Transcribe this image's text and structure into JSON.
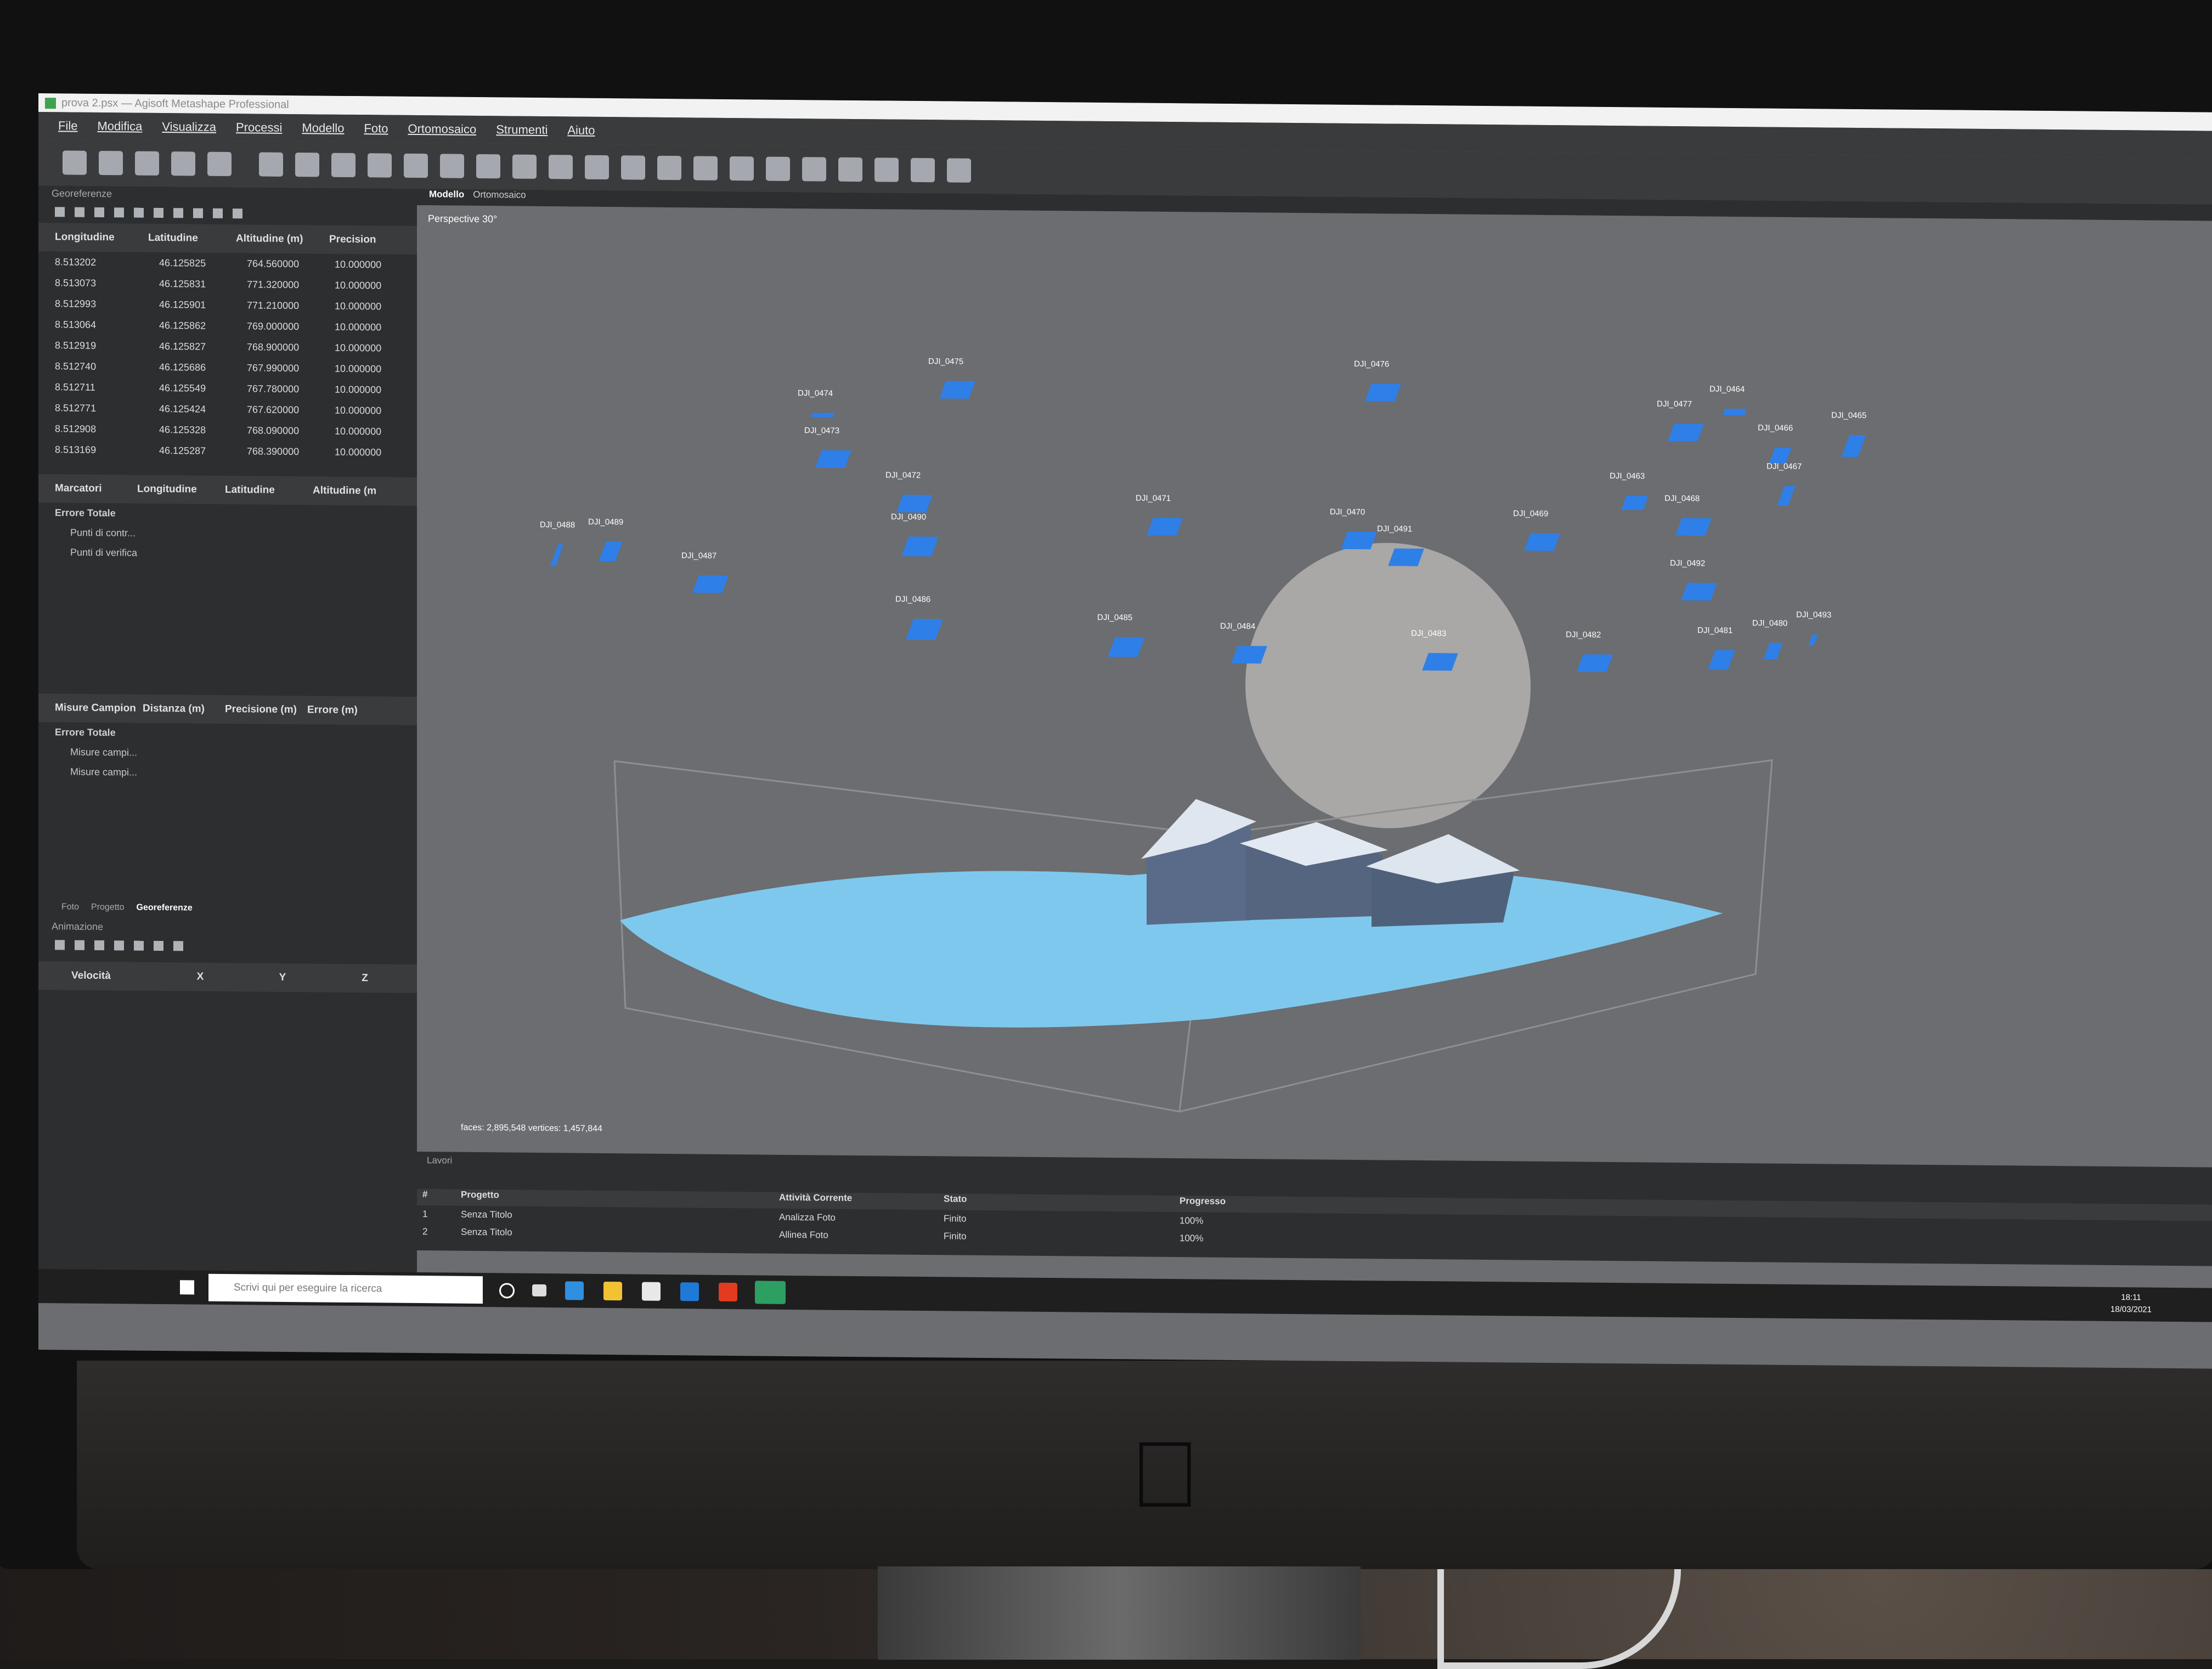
{
  "window": {
    "title": "prova 2.psx — Agisoft Metashape Professional"
  },
  "menu": [
    "File",
    "Modifica",
    "Visualizza",
    "Processi",
    "Modello",
    "Foto",
    "Ortomosaico",
    "Strumenti",
    "Aiuto"
  ],
  "georef": {
    "title": "Georeferenze",
    "columns": [
      "Longitudine",
      "Latitudine",
      "Altitudine (m)",
      "Precision"
    ],
    "rows": [
      [
        "8.513202",
        "46.125825",
        "764.560000",
        "10.000000"
      ],
      [
        "8.513073",
        "46.125831",
        "771.320000",
        "10.000000"
      ],
      [
        "8.512993",
        "46.125901",
        "771.210000",
        "10.000000"
      ],
      [
        "8.513064",
        "46.125862",
        "769.000000",
        "10.000000"
      ],
      [
        "8.512919",
        "46.125827",
        "768.900000",
        "10.000000"
      ],
      [
        "8.512740",
        "46.125686",
        "767.990000",
        "10.000000"
      ],
      [
        "8.512711",
        "46.125549",
        "767.780000",
        "10.000000"
      ],
      [
        "8.512771",
        "46.125424",
        "767.620000",
        "10.000000"
      ],
      [
        "8.512908",
        "46.125328",
        "768.090000",
        "10.000000"
      ],
      [
        "8.513169",
        "46.125287",
        "768.390000",
        "10.000000"
      ]
    ],
    "markers_columns": [
      "Marcatori",
      "Longitudine",
      "Latitudine",
      "Altitudine (m"
    ],
    "markers_total": "Errore Totale",
    "markers_items": [
      "Punti di contr...",
      "Punti di verifica"
    ],
    "scale_columns": [
      "Misure Campion",
      "Distanza (m)",
      "Precisione (m)",
      "Errore (m)"
    ],
    "scale_total": "Errore Totale",
    "scale_items": [
      "Misure campi...",
      "Misure campi..."
    ],
    "tabs": [
      "Foto",
      "Progetto",
      "Georeferenze"
    ]
  },
  "animation": {
    "title": "Animazione",
    "columns": [
      "Velocità",
      "X",
      "Y",
      "Z"
    ]
  },
  "viewport": {
    "tabs": [
      "Modello",
      "Ortomosaico"
    ],
    "perspective": "Perspective 30°",
    "stats": "faces: 2,895,548 vertices: 1,457,844",
    "cameras": [
      "DJI_0475",
      "DJI_0474",
      "DJI_0473",
      "DJI_0476",
      "DJI_0464",
      "DJI_0477",
      "DJI_0465",
      "DJI_0466",
      "DJI_0467",
      "DJI_0463",
      "DJI_0472",
      "DJI_0468",
      "DJI_0471",
      "DJI_0470",
      "DJI_0469",
      "DJI_0491",
      "DJI_0490",
      "DJI_0488",
      "DJI_0489",
      "DJI_0487",
      "DJI_0492",
      "DJI_0486",
      "DJI_0485",
      "DJI_0484",
      "DJI_0483",
      "DJI_0482",
      "DJI_0481",
      "DJI_0480",
      "DJI_0493"
    ]
  },
  "jobs": {
    "title": "Lavori",
    "columns": [
      "#",
      "Progetto",
      "Attività Corrente",
      "Stato",
      "Progresso"
    ],
    "rows": [
      [
        "1",
        "Senza Titolo",
        "Analizza Foto",
        "Finito",
        "100%"
      ],
      [
        "2",
        "Senza Titolo",
        "Allinea Foto",
        "Finito",
        "100%"
      ]
    ]
  },
  "taskbar": {
    "search_placeholder": "Scrivi qui per eseguire la ricerca",
    "time": "18:11",
    "date": "18/03/2021"
  }
}
